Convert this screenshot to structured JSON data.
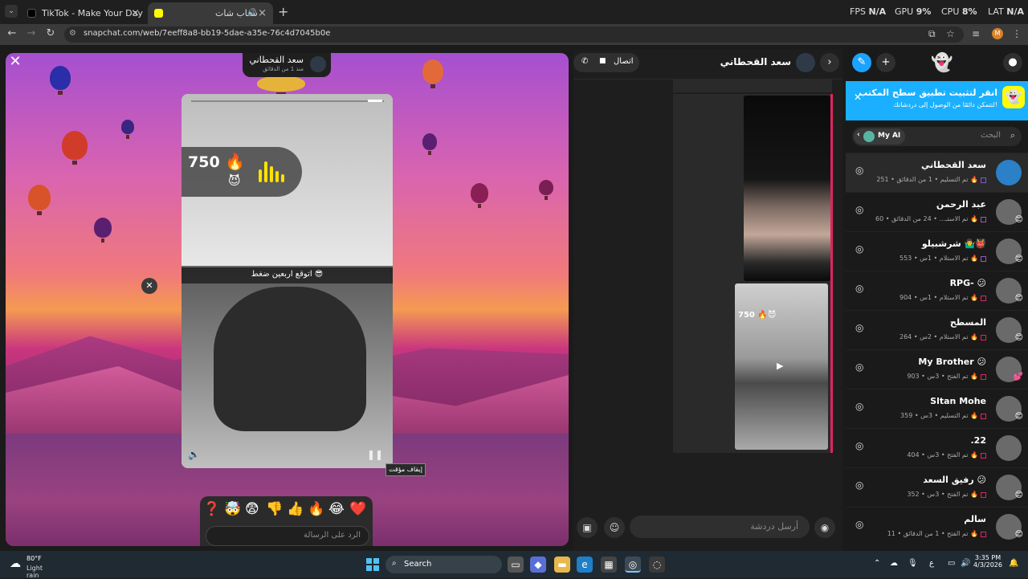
{
  "browser": {
    "tabs": [
      {
        "title": "TikTok - Make Your Day",
        "active": false
      },
      {
        "title": "سناب شات",
        "active": true
      }
    ],
    "url": "snapchat.com/web/7eeff8a8-bb19-5dae-a35e-76c4d7045b0e",
    "perf": {
      "fps_label": "FPS",
      "fps_value": "N/A",
      "gpu_label": "GPU",
      "gpu_value": "9%",
      "cpu_label": "CPU",
      "cpu_value": "8%",
      "lat_label": "LAT",
      "lat_value": "N/A"
    },
    "profile_initial": "M"
  },
  "story": {
    "sender_name": "سعد القحطاني",
    "sender_ago": "منذ 1 من الدقائق",
    "caption": "اتوقع اربعين ضغط 😎",
    "streak_number": "750",
    "streak_fire": "🔥",
    "streak_devil": "😈",
    "tooltip": "إيقاف مؤقت",
    "reply_placeholder": "الرد على الرسالة",
    "reactions": [
      "❓",
      "🤯",
      "😨",
      "👎",
      "👍",
      "🔥",
      "😂",
      "❤️"
    ],
    "progress": 0.93
  },
  "chat": {
    "title": "سعد القحطاني",
    "call_label": "اتصال",
    "input_placeholder": "أرسل دردشة",
    "snap_sticker_number": "750",
    "snap_sticker_fire": "🔥",
    "snap_sticker_devil": "😈"
  },
  "sidebar": {
    "banner_title": "انقر لتثبيت تطبيق سطح المكتب",
    "banner_subtitle": "لتتمكن دائمًا من الوصول إلى دردشاتك!",
    "search_placeholder": "البحث",
    "myai_label": "My AI",
    "conversations": [
      {
        "name": "سعد القحطاني",
        "status": "تم التسليم • 1 من الدقائق • 251 🔥",
        "badge": "",
        "colour": "#7b5bd6"
      },
      {
        "name": "عبد الرحمن",
        "status": "تم الاستـ... • 24 من الدقائق • 60 🔥",
        "badge": "😊",
        "colour": "#9b59b6"
      },
      {
        "name": "شرشبيلو 🤷‍♂️👹",
        "status": "تم الاستلام • 1س • 553 🔥",
        "badge": "😊",
        "colour": "#9b59b6"
      },
      {
        "name": "RPG- 😕",
        "status": "تم الاستلام • 1س • 904 🔥",
        "badge": "😊",
        "colour": "#e0245e"
      },
      {
        "name": "المسطح",
        "status": "تم الاستلام • 2س • 264 🔥",
        "badge": "😊",
        "colour": "#e0245e"
      },
      {
        "name": "My Brother 😕",
        "status": "تم الفتح • 3س • 903 🔥",
        "badge": "💕",
        "colour": "#e0245e"
      },
      {
        "name": "Sltan Mohe",
        "status": "تم التسليم • 3س • 359 🔥",
        "badge": "😊",
        "colour": "#e0245e"
      },
      {
        "name": ".22",
        "status": "تم الفتح • 3س • 404 🔥",
        "badge": "",
        "colour": "#e0245e"
      },
      {
        "name": "رفيق السعد 😕",
        "status": "تم الفتح • 3س • 352 🔥",
        "badge": "😊",
        "colour": "#e0245e"
      },
      {
        "name": "سالم",
        "status": "تم الفتح • 1 من الدقائق • 11 🔥",
        "badge": "😊",
        "colour": "#e0245e"
      }
    ]
  },
  "taskbar": {
    "temp": "80°F",
    "condition": "Light rain",
    "search_label": "Search",
    "time": "3:35 PM",
    "date": "4/3/2026",
    "lang": "ع"
  }
}
